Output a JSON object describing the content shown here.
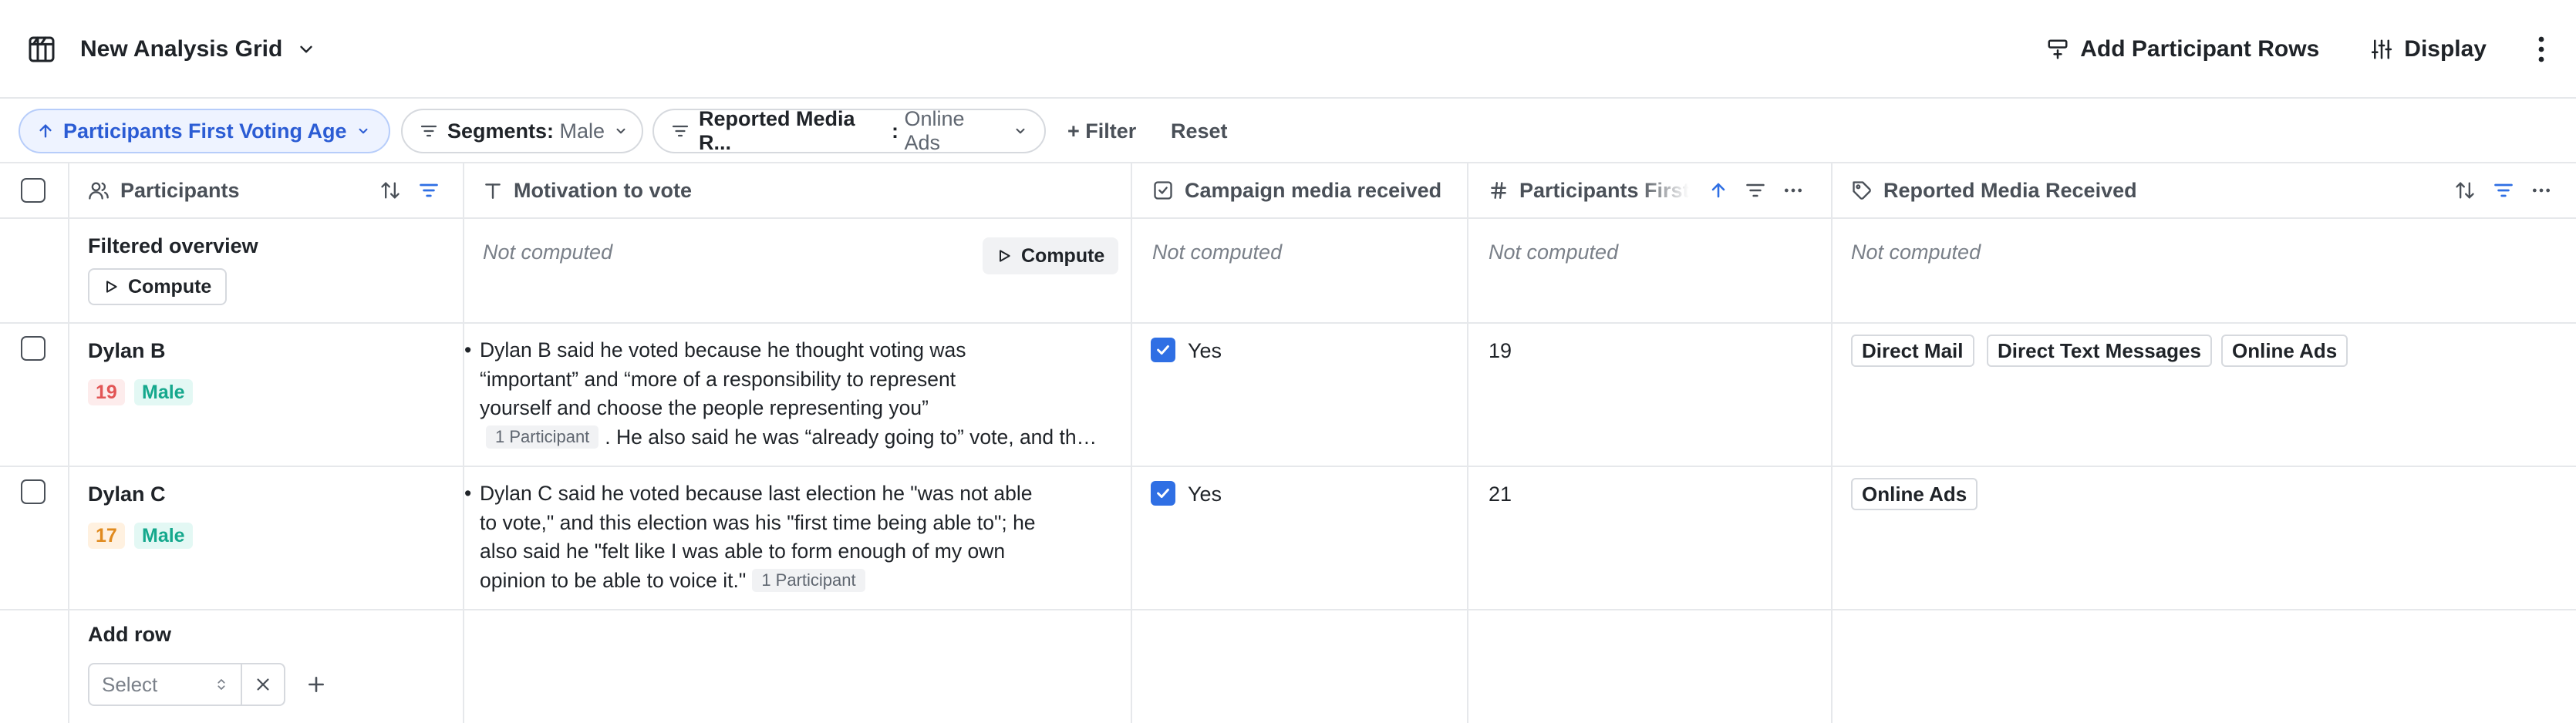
{
  "header": {
    "title": "New Analysis Grid",
    "add_rows_label": "Add Participant Rows",
    "display_label": "Display"
  },
  "filters": {
    "sort_chip": "Participants First Voting Age",
    "segments_label": "Segments",
    "segments_value": "Male",
    "media_label": "Reported Media R...",
    "media_value": "Online Ads",
    "add_filter": "+ Filter",
    "reset": "Reset"
  },
  "columns": [
    {
      "label": "Participants"
    },
    {
      "label": "Motivation to vote"
    },
    {
      "label": "Campaign media received"
    },
    {
      "label": "Participants First Voting Age"
    },
    {
      "label": "Reported Media Received"
    }
  ],
  "overview": {
    "title": "Filtered overview",
    "compute_label": "Compute",
    "not_computed": "Not computed"
  },
  "rows": [
    {
      "name": "Dylan B",
      "age": "19",
      "gender": "Male",
      "motivation_lines": [
        "Dylan B said he voted because he thought voting was",
        "“important” and “more of a responsibility to represent",
        "yourself and choose the people representing you”"
      ],
      "motivation_pill": "1 Participant",
      "motivation_tail": ". He also said he was “already going to” vote, and that voting was something he wanted to do",
      "media_received": "Yes",
      "first_voting_age": "19",
      "tags": [
        "Direct Mail",
        "Direct Text Messages",
        "Online Ads"
      ]
    },
    {
      "name": "Dylan C",
      "age": "17",
      "gender": "Male",
      "motivation_lines": [
        "Dylan C said he voted because last election he \"was not able",
        "to vote,\" and this election was his \"first time being able to\"; he",
        "also said he \"felt like I was able to form enough of my own"
      ],
      "motivation_last": "opinion to be able to voice it.\"",
      "motivation_pill": "1 Participant",
      "media_received": "Yes",
      "first_voting_age": "21",
      "tags": [
        "Online Ads"
      ]
    }
  ],
  "add_row": {
    "title": "Add row",
    "select_placeholder": "Select"
  }
}
